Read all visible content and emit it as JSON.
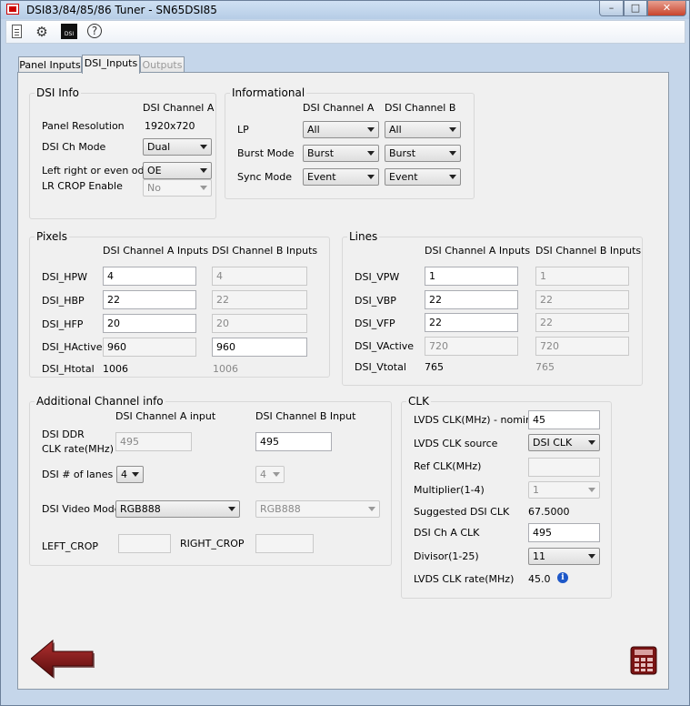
{
  "window": {
    "title": "DSI83/84/85/86 Tuner - SN65DSI85",
    "controls": {
      "minimize": "–",
      "maximize": "□",
      "close": "✕"
    }
  },
  "toolbar": {
    "icons": [
      "document-icon",
      "gear-icon",
      "dsi-icon",
      "help-icon"
    ],
    "dsi_text": "DSI",
    "help_text": "?"
  },
  "tabs": [
    {
      "label": "Panel Inputs",
      "state": "normal"
    },
    {
      "label": "DSI_Inputs",
      "state": "selected"
    },
    {
      "label": "Outputs",
      "state": "disabled"
    }
  ],
  "dsi_info": {
    "title": "DSI Info",
    "col_header": "DSI Channel A",
    "panel_resolution_label": "Panel Resolution",
    "panel_resolution_value": "1920x720",
    "ch_mode_label": "DSI Ch Mode",
    "ch_mode_value": "Dual",
    "left_right_label": "Left right or even odd",
    "left_right_value": "OE",
    "lr_crop_label": "LR CROP Enable",
    "lr_crop_value": "No"
  },
  "informational": {
    "title": "Informational",
    "col_a": "DSI Channel A",
    "col_b": "DSI Channel B",
    "rows": [
      {
        "label": "LP",
        "a": "All",
        "b": "All"
      },
      {
        "label": "Burst Mode",
        "a": "Burst",
        "b": "Burst"
      },
      {
        "label": "Sync Mode",
        "a": "Event",
        "b": "Event"
      }
    ]
  },
  "pixels": {
    "title": "Pixels",
    "col_a": "DSI Channel A Inputs",
    "col_b": "DSI Channel B Inputs",
    "rows": [
      {
        "label": "DSI_HPW",
        "a": "4",
        "b": "4"
      },
      {
        "label": "DSI_HBP",
        "a": "22",
        "b": "22"
      },
      {
        "label": "DSI_HFP",
        "a": "20",
        "b": "20"
      },
      {
        "label": "DSI_HActive",
        "a": "960",
        "b": "960"
      },
      {
        "label": "DSI_Htotal",
        "a": "1006",
        "b": "1006"
      }
    ]
  },
  "lines": {
    "title": "Lines",
    "col_a": "DSI Channel A Inputs",
    "col_b": "DSI Channel B Inputs",
    "rows": [
      {
        "label": "DSI_VPW",
        "a": "1",
        "b": "1"
      },
      {
        "label": "DSI_VBP",
        "a": "22",
        "b": "22"
      },
      {
        "label": "DSI_VFP",
        "a": "22",
        "b": "22"
      },
      {
        "label": "DSI_VActive",
        "a": "720",
        "b": "720"
      },
      {
        "label": "DSI_Vtotal",
        "a": "765",
        "b": "765"
      }
    ]
  },
  "additional": {
    "title": "Additional Channel info",
    "col_a": "DSI Channel A input",
    "col_b": "DSI Channel B Input",
    "ddr_label_1": "DSI DDR",
    "ddr_label_2": "CLK rate(MHz)",
    "ddr_a": "495",
    "ddr_b": "495",
    "lanes_label": "DSI # of lanes",
    "lanes_a": "4",
    "lanes_b": "4",
    "video_mode_label": "DSI Video Mode",
    "video_mode_a": "RGB888",
    "video_mode_b": "RGB888",
    "left_crop_label": "LEFT_CROP",
    "left_crop_value": "",
    "right_crop_label": "RIGHT_CROP",
    "right_crop_value": ""
  },
  "clk": {
    "title": "CLK",
    "lvds_nominal_label": "LVDS CLK(MHz) - nominal",
    "lvds_nominal_value": "45",
    "lvds_source_label": "LVDS CLK source",
    "lvds_source_value": "DSI CLK",
    "ref_clk_label": "Ref CLK(MHz)",
    "ref_clk_value": "",
    "multiplier_label": "Multiplier(1-4)",
    "multiplier_value": "1",
    "suggested_label": "Suggested DSI CLK",
    "suggested_value": "67.5000",
    "ch_a_clk_label": "DSI Ch A CLK",
    "ch_a_clk_value": "495",
    "divisor_label": "Divisor(1-25)",
    "divisor_value": "11",
    "rate_label": "LVDS CLK rate(MHz)",
    "rate_value": "45.0",
    "info_text": "i"
  },
  "colors": {
    "accent_arrow": "#8b1a1a",
    "calc": "#7a1414",
    "info": "#1e58c8"
  }
}
